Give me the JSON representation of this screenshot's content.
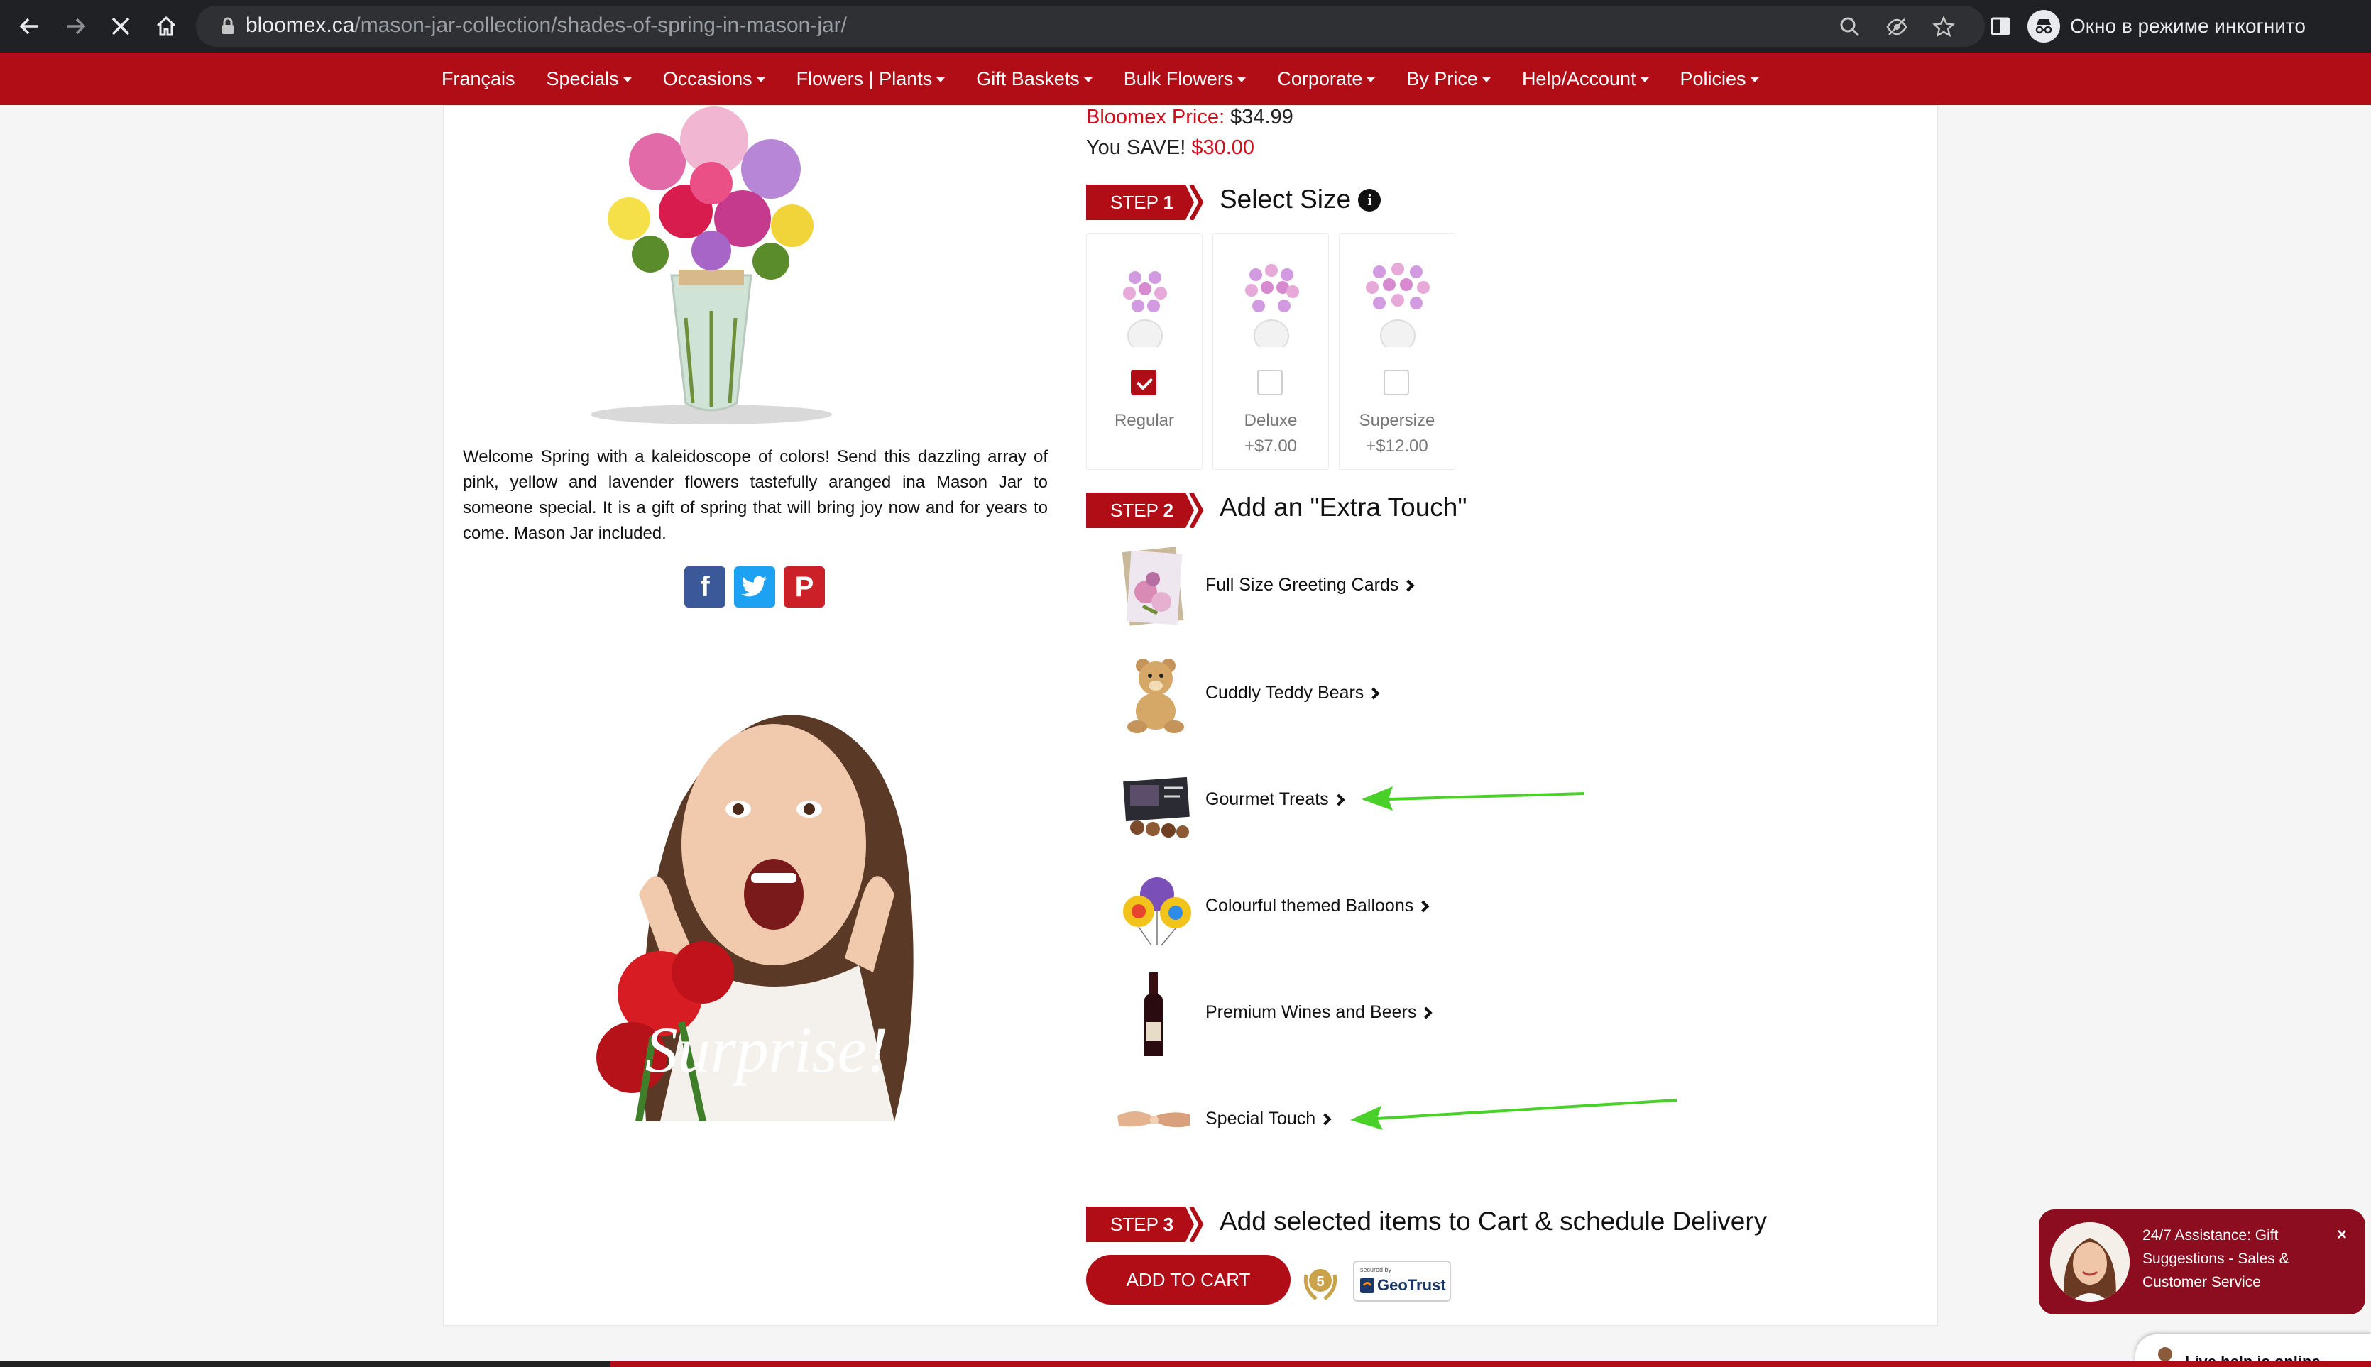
{
  "browser": {
    "url_host": "bloomex.ca",
    "url_path": "/mason-jar-collection/shades-of-spring-in-mason-jar/",
    "incognito_label": "Окно в режиме инкогнито"
  },
  "menu": {
    "items": [
      {
        "label": "Français",
        "dropdown": false
      },
      {
        "label": "Specials",
        "dropdown": true
      },
      {
        "label": "Occasions",
        "dropdown": true
      },
      {
        "label": "Flowers | Plants",
        "dropdown": true
      },
      {
        "label": "Gift Baskets",
        "dropdown": true
      },
      {
        "label": "Bulk Flowers",
        "dropdown": true
      },
      {
        "label": "Corporate",
        "dropdown": true
      },
      {
        "label": "By Price",
        "dropdown": true
      },
      {
        "label": "Help/Account",
        "dropdown": true
      },
      {
        "label": "Policies",
        "dropdown": true
      }
    ]
  },
  "product": {
    "description": "Welcome Spring with a kaleidoscope of colors! Send this dazzling array of pink, yellow and lavender flowers tastefully aranged ina Mason Jar to someone special. It is a gift of spring that will bring joy now and for years to come. Mason Jar included.",
    "promo_text": "Surprise!"
  },
  "social": {
    "facebook_icon": "f",
    "twitter_icon": "t",
    "pinterest_icon": "P"
  },
  "price": {
    "label": "Bloomex Price:",
    "value": "$34.99",
    "save_label": "You SAVE!",
    "save_value": "$30.00"
  },
  "step1": {
    "step_word": "STEP",
    "step_number": "1",
    "title": "Select Size",
    "sizes": [
      {
        "name": "Regular",
        "price": "",
        "checked": true
      },
      {
        "name": "Deluxe",
        "price": "+$7.00",
        "checked": false
      },
      {
        "name": "Supersize",
        "price": "+$12.00",
        "checked": false
      }
    ]
  },
  "step2": {
    "step_word": "STEP",
    "step_number": "2",
    "title": "Add an \"Extra Touch\"",
    "extras": [
      {
        "label": "Full Size Greeting Cards"
      },
      {
        "label": "Cuddly Teddy Bears"
      },
      {
        "label": "Gourmet Treats"
      },
      {
        "label": "Colourful themed Balloons"
      },
      {
        "label": "Premium Wines and Beers"
      },
      {
        "label": "Special Touch"
      }
    ]
  },
  "step3": {
    "step_word": "STEP",
    "step_number": "3",
    "title": "Add selected items to Cart & schedule Delivery",
    "add_to_cart": "ADD TO CART",
    "geotrust_small": "secured by",
    "geotrust_name": "GeoTrust"
  },
  "chat": {
    "text": "24/7 Assistance: Gift Suggestions - Sales & Customer Service",
    "close": "×",
    "live_help": "Live help is online"
  },
  "colors": {
    "brand_red": "#b00d17",
    "price_red": "#d00f1d",
    "annotation_green": "#49d12a"
  }
}
